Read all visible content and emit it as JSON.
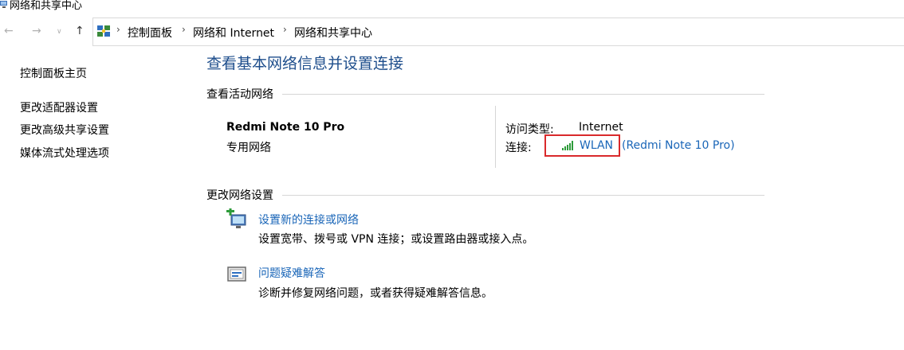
{
  "window": {
    "title": "网络和共享中心",
    "icon": "network-center-icon"
  },
  "navigation": {
    "back_icon": "arrow-left-icon",
    "forward_icon": "arrow-right-icon",
    "history_icon": "chevron-down-icon",
    "up_icon": "arrow-up-icon"
  },
  "breadcrumb": {
    "items": [
      "控制面板",
      "网络和 Internet",
      "网络和共享中心"
    ],
    "separator_icon": "chevron-right-icon"
  },
  "sidebar": {
    "items": [
      {
        "label": "控制面板主页"
      },
      {
        "label": "更改适配器设置"
      },
      {
        "label": "更改高级共享设置"
      },
      {
        "label": "媒体流式处理选项"
      }
    ]
  },
  "main": {
    "title": "查看基本网络信息并设置连接",
    "active_networks": {
      "heading": "查看活动网络",
      "network_name": "Redmi Note 10 Pro",
      "network_type": "专用网络",
      "access_type_label": "访问类型:",
      "access_type_value": "Internet",
      "connection_label": "连接:",
      "connection_icon": "wifi-signal-icon",
      "connection_link": "WLAN",
      "connection_ssid": "(Redmi Note 10 Pro)"
    },
    "change_settings": {
      "heading": "更改网络设置",
      "tasks": [
        {
          "icon": "new-connection-icon",
          "link": "设置新的连接或网络",
          "description": "设置宽带、拨号或 VPN 连接；或设置路由器或接入点。"
        },
        {
          "icon": "troubleshoot-icon",
          "link": "问题疑难解答",
          "description": "诊断并修复网络问题，或者获得疑难解答信息。"
        }
      ]
    }
  },
  "colors": {
    "title_blue": "#1e4e8c",
    "link_blue": "#1a66b8",
    "highlight_red": "#d9292b",
    "signal_green": "#2e9b3a"
  }
}
